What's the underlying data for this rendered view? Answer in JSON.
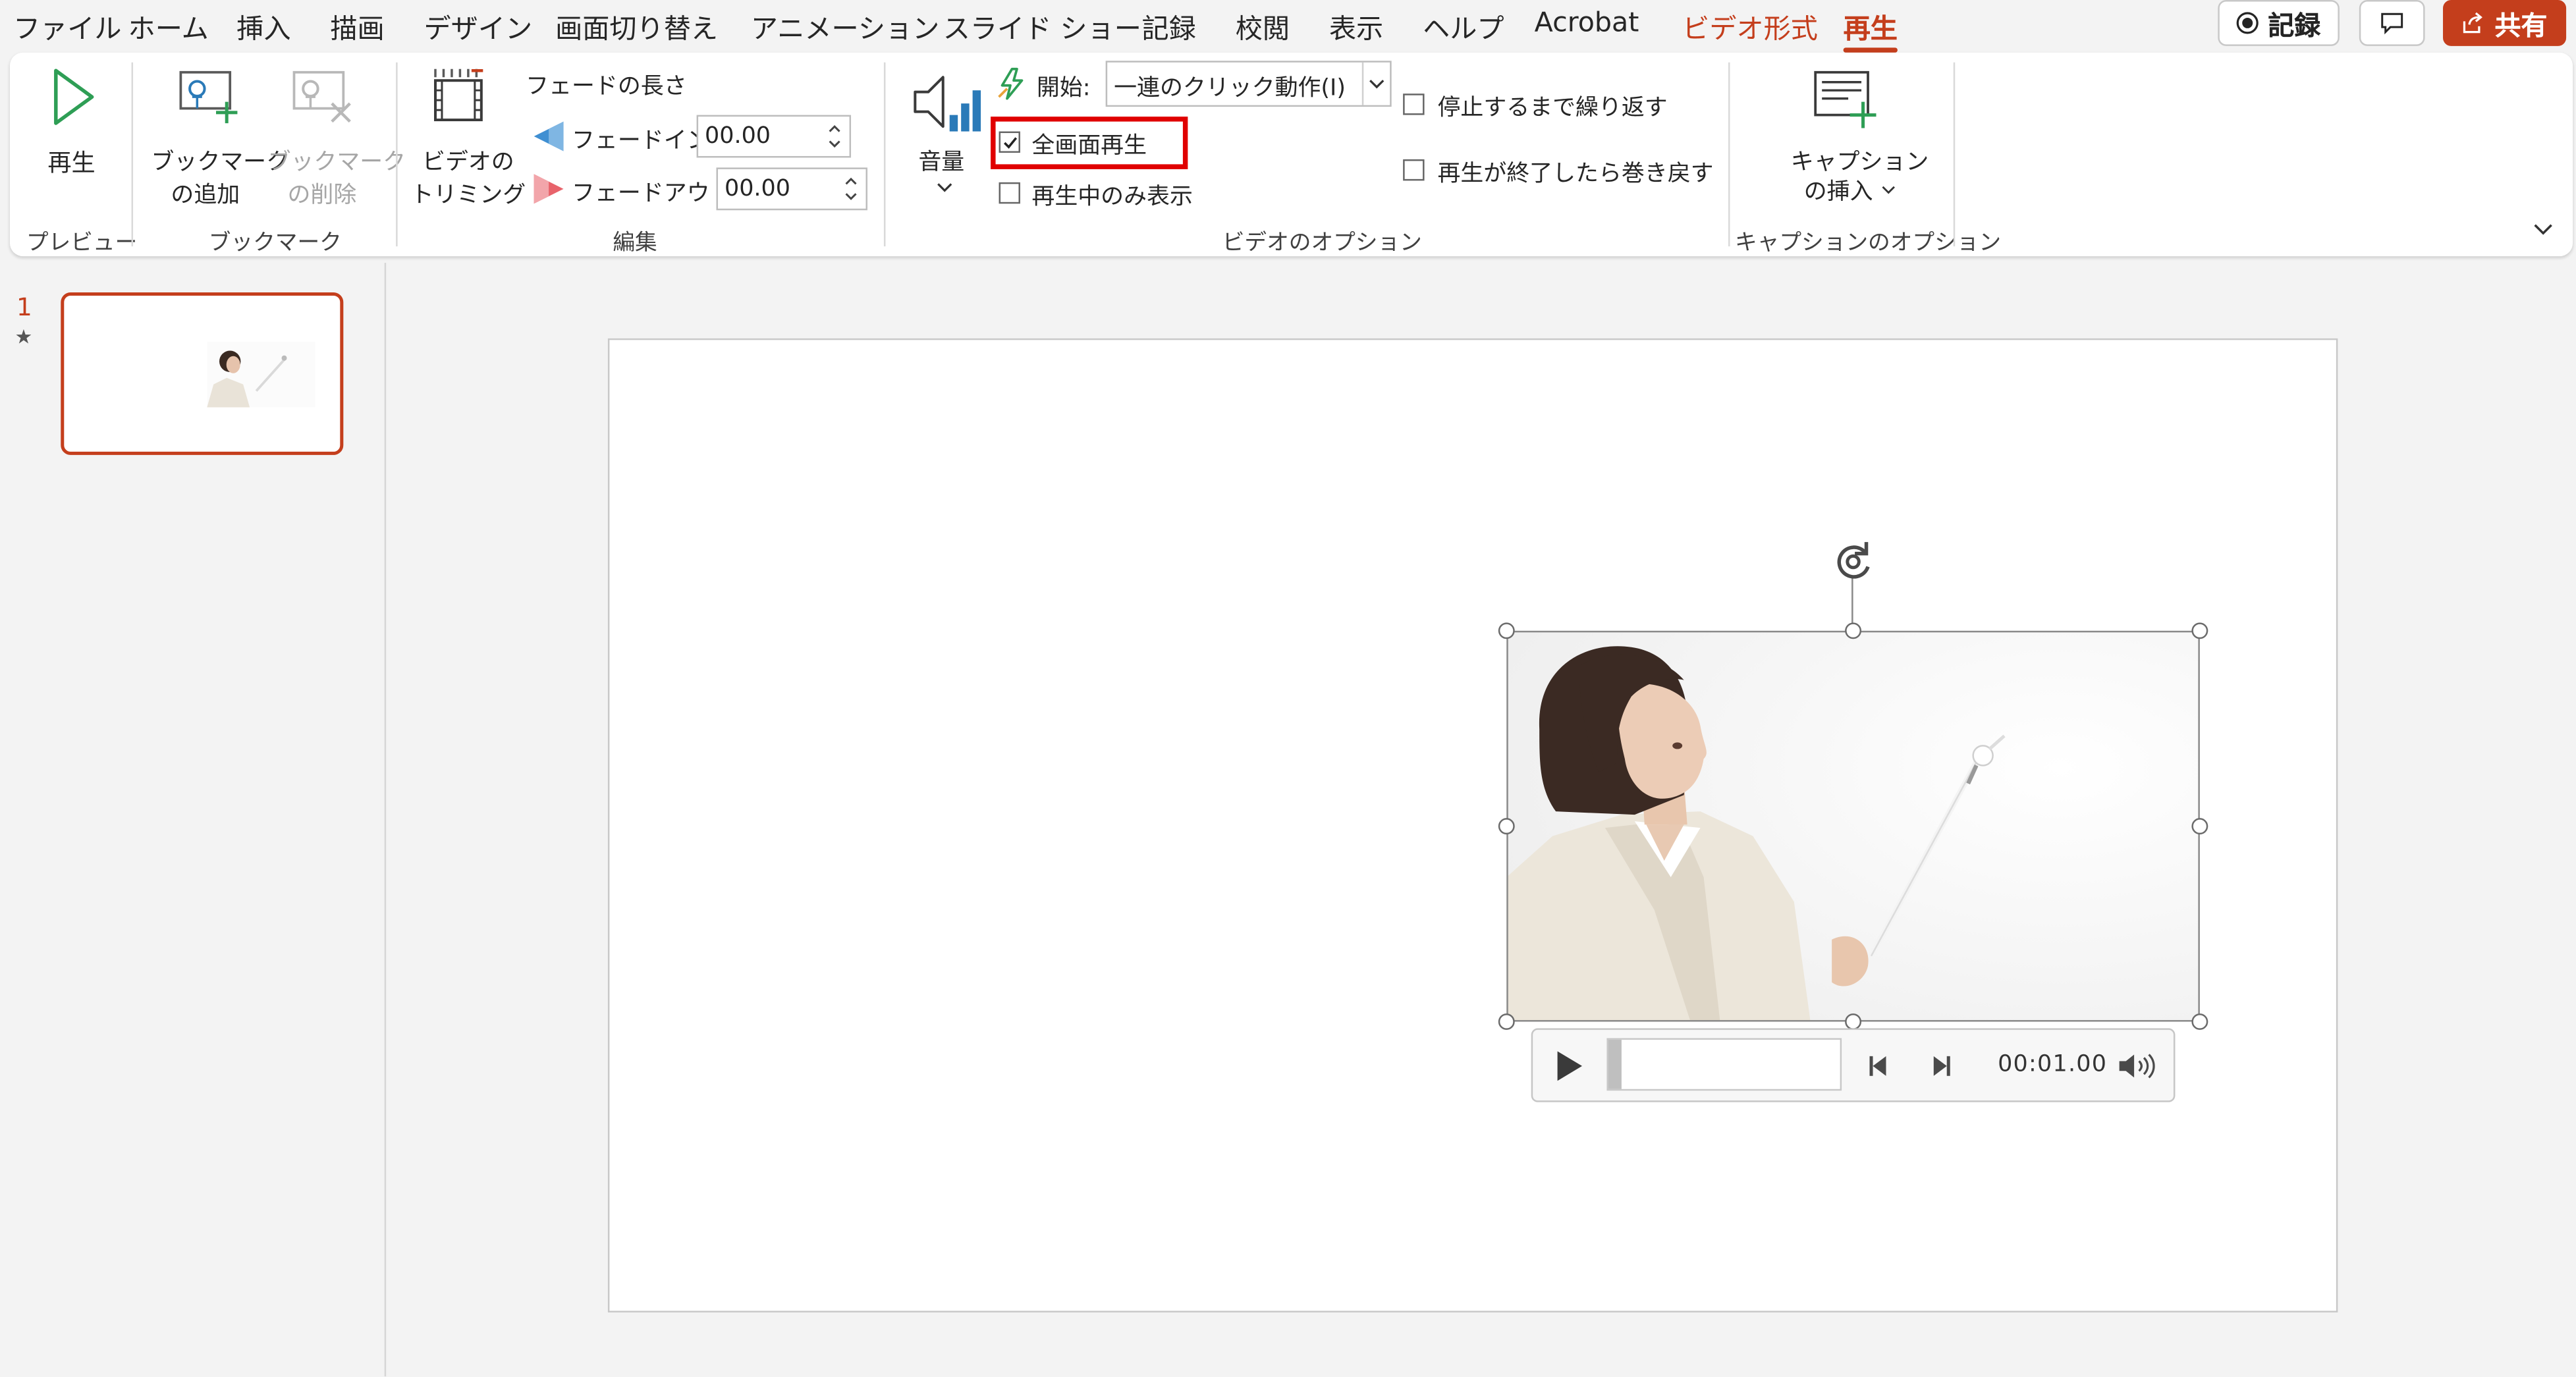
{
  "menu": {
    "file": "ファイル",
    "home": "ホーム",
    "insert": "挿入",
    "draw": "描画",
    "design": "デザイン",
    "transitions": "画面切り替え",
    "animations": "アニメーション",
    "slideshow": "スライド ショー",
    "record": "記録",
    "review": "校閲",
    "view": "表示",
    "help": "ヘルプ",
    "acrobat": "Acrobat",
    "video_format": "ビデオ形式",
    "playback": "再生"
  },
  "top_buttons": {
    "record": "記録",
    "share": "共有"
  },
  "ribbon": {
    "preview": {
      "play": "再生",
      "group": "プレビュー"
    },
    "bookmarks": {
      "add_l1": "ブックマーク",
      "add_l2": "の追加",
      "remove_l1": "ブックマーク",
      "remove_l2": "の削除",
      "group": "ブックマーク"
    },
    "editing": {
      "trim_l1": "ビデオの",
      "trim_l2": "トリミング",
      "fade_title": "フェードの長さ",
      "fade_in_label": "フェードイン:",
      "fade_in_value": "00.00",
      "fade_out_label": "フェードアウト:",
      "fade_out_value": "00.00",
      "group": "編集"
    },
    "video_options": {
      "volume": "音量",
      "start_label": "開始:",
      "start_value": "一連のクリック動作(I)",
      "fullscreen": "全画面再生",
      "fullscreen_checked": true,
      "hide_while_not_playing": "再生中のみ表示",
      "loop": "停止するまで繰り返す",
      "rewind": "再生が終了したら巻き戻す",
      "group": "ビデオのオプション"
    },
    "caption_options": {
      "insert_l1": "キャプション",
      "insert_l2": "の挿入",
      "group": "キャプションのオプション"
    }
  },
  "thumbnails": [
    {
      "number": "1",
      "star": "★"
    }
  ],
  "player": {
    "time": "00:01.00"
  },
  "colors": {
    "accent": "#c43e1c",
    "highlight_box": "#e00000",
    "play_green": "#2e9e55"
  }
}
